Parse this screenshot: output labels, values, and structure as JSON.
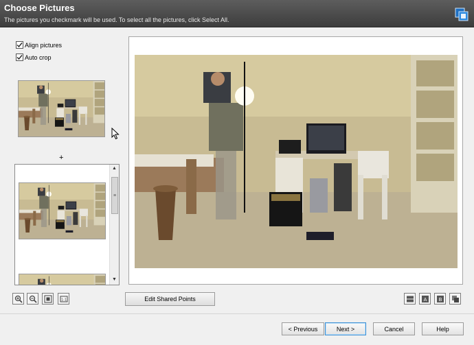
{
  "header": {
    "title": "Choose Pictures",
    "subtitle": "The pictures you checkmark will be used. To select all the pictures, click Select All."
  },
  "options": {
    "align_pictures": {
      "label": "Align pictures",
      "checked": true
    },
    "auto_crop": {
      "label": "Auto crop",
      "checked": true
    }
  },
  "plus_sign": "+",
  "toolbar": {
    "edit_shared_points": "Edit Shared Points",
    "left_icons": [
      "zoom-in-icon",
      "zoom-out-icon",
      "fit-to-window-icon",
      "actual-size-icon"
    ],
    "right_icons": [
      "split-view-icon",
      "view-a-icon",
      "view-b-icon",
      "overlay-view-icon"
    ]
  },
  "footer": {
    "previous": "< Previous",
    "next": "Next >",
    "cancel": "Cancel",
    "help": "Help"
  },
  "colors": {
    "header_bg": "#4a4a4a",
    "primary_button_border": "#3c8fd4"
  }
}
